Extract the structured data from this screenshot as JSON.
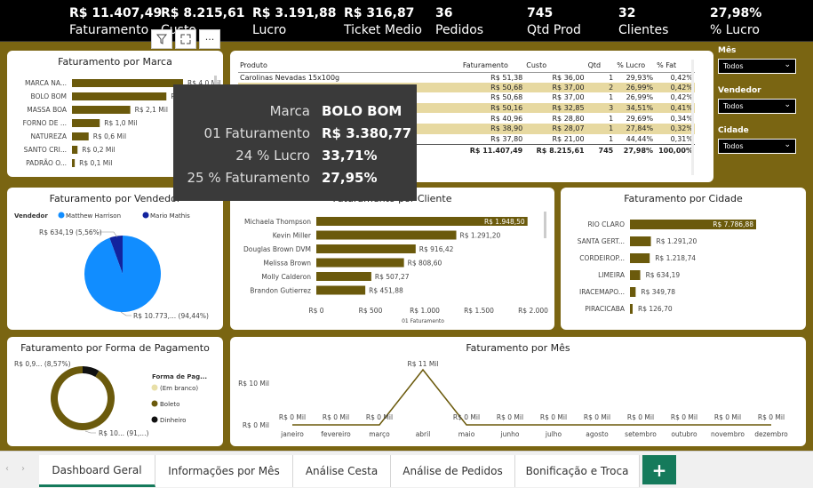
{
  "kpis": [
    {
      "value": "R$ 11.407,49",
      "label": "Faturamento"
    },
    {
      "value": "R$ 8.215,61",
      "label": "Custo"
    },
    {
      "value": "R$ 3.191,88",
      "label": "Lucro"
    },
    {
      "value": "R$ 316,87",
      "label": "Ticket Medio"
    },
    {
      "value": "36",
      "label": "Pedidos"
    },
    {
      "value": "745",
      "label": "Qtd Prod"
    },
    {
      "value": "32",
      "label": "Clientes"
    },
    {
      "value": "27,98%",
      "label": "% Lucro"
    }
  ],
  "marca": {
    "title": "Faturamento por Marca",
    "items": [
      {
        "name": "MARCA NA...",
        "value": 4.0,
        "label": "R$ 4,0 Mil"
      },
      {
        "name": "BOLO BOM",
        "value": 3.4,
        "label": "R$ 3,4 Mil"
      },
      {
        "name": "MASSA BOA",
        "value": 2.1,
        "label": "R$ 2,1 Mil"
      },
      {
        "name": "FORNO DE ...",
        "value": 1.0,
        "label": "R$ 1,0 Mil"
      },
      {
        "name": "NATUREZA",
        "value": 0.6,
        "label": "R$ 0,6 Mil"
      },
      {
        "name": "SANTO CRI...",
        "value": 0.2,
        "label": "R$ 0,2 Mil"
      },
      {
        "name": "PADRÃO O...",
        "value": 0.1,
        "label": "R$ 0,1 Mil"
      }
    ]
  },
  "tooltip": {
    "rows": [
      {
        "k": "Marca",
        "v": "BOLO BOM"
      },
      {
        "k": "01 Faturamento",
        "v": "R$ 3.380,77"
      },
      {
        "k": "24 % Lucro",
        "v": "33,71%"
      },
      {
        "k": "25 % Faturamento",
        "v": "27,95%"
      }
    ]
  },
  "visual_header": {
    "filter_icon": "filter-icon",
    "focus_icon": "focus-mode-icon",
    "more": "···"
  },
  "produtos": {
    "headers": [
      "Produto",
      "Faturamento",
      "Custo",
      "Qtd",
      "% Lucro",
      "% Fat"
    ],
    "rows": [
      {
        "p": "Carolinas Nevadas 15x100g",
        "f": "R$ 51,38",
        "c": "R$ 36,00",
        "q": "1",
        "l": "29,93%",
        "pf": "0,42%",
        "hl": false
      },
      {
        "p": "",
        "f": "R$ 50,68",
        "c": "R$ 37,00",
        "q": "2",
        "l": "26,99%",
        "pf": "0,42%",
        "hl": true
      },
      {
        "p": "KG",
        "f": "R$ 50,68",
        "c": "R$ 37,00",
        "q": "1",
        "l": "26,99%",
        "pf": "0,42%",
        "hl": false
      },
      {
        "p": "",
        "f": "R$ 50,16",
        "c": "R$ 32,85",
        "q": "3",
        "l": "34,51%",
        "pf": "0,41%",
        "hl": true
      },
      {
        "p": "",
        "f": "R$ 40,96",
        "c": "R$ 28,80",
        "q": "1",
        "l": "29,69%",
        "pf": "0,34%",
        "hl": false
      },
      {
        "p": "",
        "f": "R$ 38,90",
        "c": "R$ 28,07",
        "q": "1",
        "l": "27,84%",
        "pf": "0,32%",
        "hl": true
      },
      {
        "p": "UND",
        "f": "R$ 37,80",
        "c": "R$ 21,00",
        "q": "1",
        "l": "44,44%",
        "pf": "0,31%",
        "hl": false
      }
    ],
    "total": {
      "p": "",
      "f": "R$ 11.407,49",
      "c": "R$ 8.215,61",
      "q": "745",
      "l": "27,98%",
      "pf": "100,00%"
    }
  },
  "slicers": [
    {
      "title": "Mês",
      "value": "Todos"
    },
    {
      "title": "Vendedor",
      "value": "Todos"
    },
    {
      "title": "Cidade",
      "value": "Todos"
    }
  ],
  "vendedor": {
    "title": "Faturamento por Vendedor",
    "legend_title": "Vendedor",
    "legend": [
      {
        "name": "Matthew Harrison",
        "color": "#118dff"
      },
      {
        "name": "Mario Mathis",
        "color": "#12239e"
      }
    ],
    "slices": [
      {
        "name": "Matthew Harrison",
        "value": 94.44,
        "label": "R$ 10.773,... (94,44%)"
      },
      {
        "name": "Mario Mathis",
        "value": 5.56,
        "label": "R$ 634,19 (5,56%)"
      }
    ]
  },
  "cliente": {
    "title": "Faturamento por Cliente",
    "xlabel": "01 Faturamento",
    "ticks": [
      "R$ 0",
      "R$ 500",
      "R$ 1.000",
      "R$ 1.500",
      "R$ 2.000"
    ],
    "items": [
      {
        "name": "Michaela Thompson",
        "value": 1948.5,
        "label": "R$ 1.948,50"
      },
      {
        "name": "Kevin Miller",
        "value": 1291.2,
        "label": "R$ 1.291,20"
      },
      {
        "name": "Douglas Brown DVM",
        "value": 916.42,
        "label": "R$ 916,42"
      },
      {
        "name": "Melissa Brown",
        "value": 808.6,
        "label": "R$ 808,60"
      },
      {
        "name": "Molly Calderon",
        "value": 507.27,
        "label": "R$ 507,27"
      },
      {
        "name": "Brandon Gutierrez",
        "value": 451.88,
        "label": "R$ 451,88"
      }
    ]
  },
  "cidade": {
    "title": "Faturamento por Cidade",
    "items": [
      {
        "name": "RIO CLARO",
        "value": 7786.88,
        "label": "R$ 7.786,88"
      },
      {
        "name": "SANTA GERT...",
        "value": 1291.2,
        "label": "R$ 1.291,20"
      },
      {
        "name": "CORDEIROP...",
        "value": 1218.74,
        "label": "R$ 1.218,74"
      },
      {
        "name": "LIMEIRA",
        "value": 634.19,
        "label": "R$ 634,19"
      },
      {
        "name": "IRACEMAPO...",
        "value": 349.78,
        "label": "R$ 349,78"
      },
      {
        "name": "PIRACICABA",
        "value": 126.7,
        "label": "R$ 126,70"
      }
    ]
  },
  "pagamento": {
    "title": "Faturamento por Forma de Pagamento",
    "legend_title": "Forma de Pag...",
    "legend": [
      {
        "name": "(Em branco)",
        "color": "#e8dfa8"
      },
      {
        "name": "Boleto",
        "color": "#6b5a0c"
      },
      {
        "name": "Dinheiro",
        "color": "#111111"
      }
    ],
    "slices": [
      {
        "name": "Boleto",
        "value": 91.43,
        "label": "R$ 10... (91,...)"
      },
      {
        "name": "Dinheiro",
        "value": 8.57,
        "label": "R$ 0,9... (8,57%)"
      }
    ]
  },
  "mes": {
    "title": "Faturamento por Mês",
    "yticks": [
      "R$ 10 Mil",
      "R$ 0 Mil"
    ],
    "months": [
      "janeiro",
      "fevereiro",
      "março",
      "abril",
      "maio",
      "junho",
      "julho",
      "agosto",
      "setembro",
      "outubro",
      "novembro",
      "dezembro"
    ],
    "values": [
      0,
      0,
      0,
      11,
      0,
      0,
      0,
      0,
      0,
      0,
      0,
      0
    ],
    "labels": [
      "R$ 0 Mil",
      "R$ 0 Mil",
      "R$ 0 Mil",
      "R$ 11 Mil",
      "R$ 0 Mil",
      "R$ 0 Mil",
      "R$ 0 Mil",
      "R$ 0 Mil",
      "R$ 0 Mil",
      "R$ 0 Mil",
      "R$ 0 Mil",
      "R$ 0 Mil"
    ]
  },
  "tabs": [
    "Dashboard Geral",
    "Informações por Mês",
    "Análise Cesta",
    "Análise de Pedidos",
    "Bonificação e Troca"
  ],
  "tab_add": "+",
  "colors": {
    "brand": "#6b5a0c",
    "background": "#7a6512",
    "accent": "#157a5b"
  },
  "chart_data": [
    {
      "type": "bar",
      "title": "Faturamento por Marca",
      "categories": [
        "MARCA NA...",
        "BOLO BOM",
        "MASSA BOA",
        "FORNO DE ...",
        "NATUREZA",
        "SANTO CRI...",
        "PADRÃO O..."
      ],
      "values": [
        4.0,
        3.4,
        2.1,
        1.0,
        0.6,
        0.2,
        0.1
      ]
    },
    {
      "type": "pie",
      "title": "Faturamento por Vendedor",
      "categories": [
        "Matthew Harrison",
        "Mario Mathis"
      ],
      "values": [
        94.44,
        5.56
      ]
    },
    {
      "type": "bar",
      "title": "Faturamento por Cliente",
      "xlabel": "01 Faturamento",
      "categories": [
        "Michaela Thompson",
        "Kevin Miller",
        "Douglas Brown DVM",
        "Melissa Brown",
        "Molly Calderon",
        "Brandon Gutierrez"
      ],
      "values": [
        1948.5,
        1291.2,
        916.42,
        808.6,
        507.27,
        451.88
      ],
      "xlim": [
        0,
        2000
      ]
    },
    {
      "type": "bar",
      "title": "Faturamento por Cidade",
      "categories": [
        "RIO CLARO",
        "SANTA GERT...",
        "CORDEIROP...",
        "LIMEIRA",
        "IRACEMAPO...",
        "PIRACICABA"
      ],
      "values": [
        7786.88,
        1291.2,
        1218.74,
        634.19,
        349.78,
        126.7
      ]
    },
    {
      "type": "pie",
      "title": "Faturamento por Forma de Pagamento",
      "categories": [
        "Boleto",
        "Dinheiro"
      ],
      "values": [
        91.43,
        8.57
      ]
    },
    {
      "type": "line",
      "title": "Faturamento por Mês",
      "categories": [
        "janeiro",
        "fevereiro",
        "março",
        "abril",
        "maio",
        "junho",
        "julho",
        "agosto",
        "setembro",
        "outubro",
        "novembro",
        "dezembro"
      ],
      "values": [
        0,
        0,
        0,
        11,
        0,
        0,
        0,
        0,
        0,
        0,
        0,
        0
      ],
      "ylim": [
        0,
        11
      ]
    }
  ]
}
